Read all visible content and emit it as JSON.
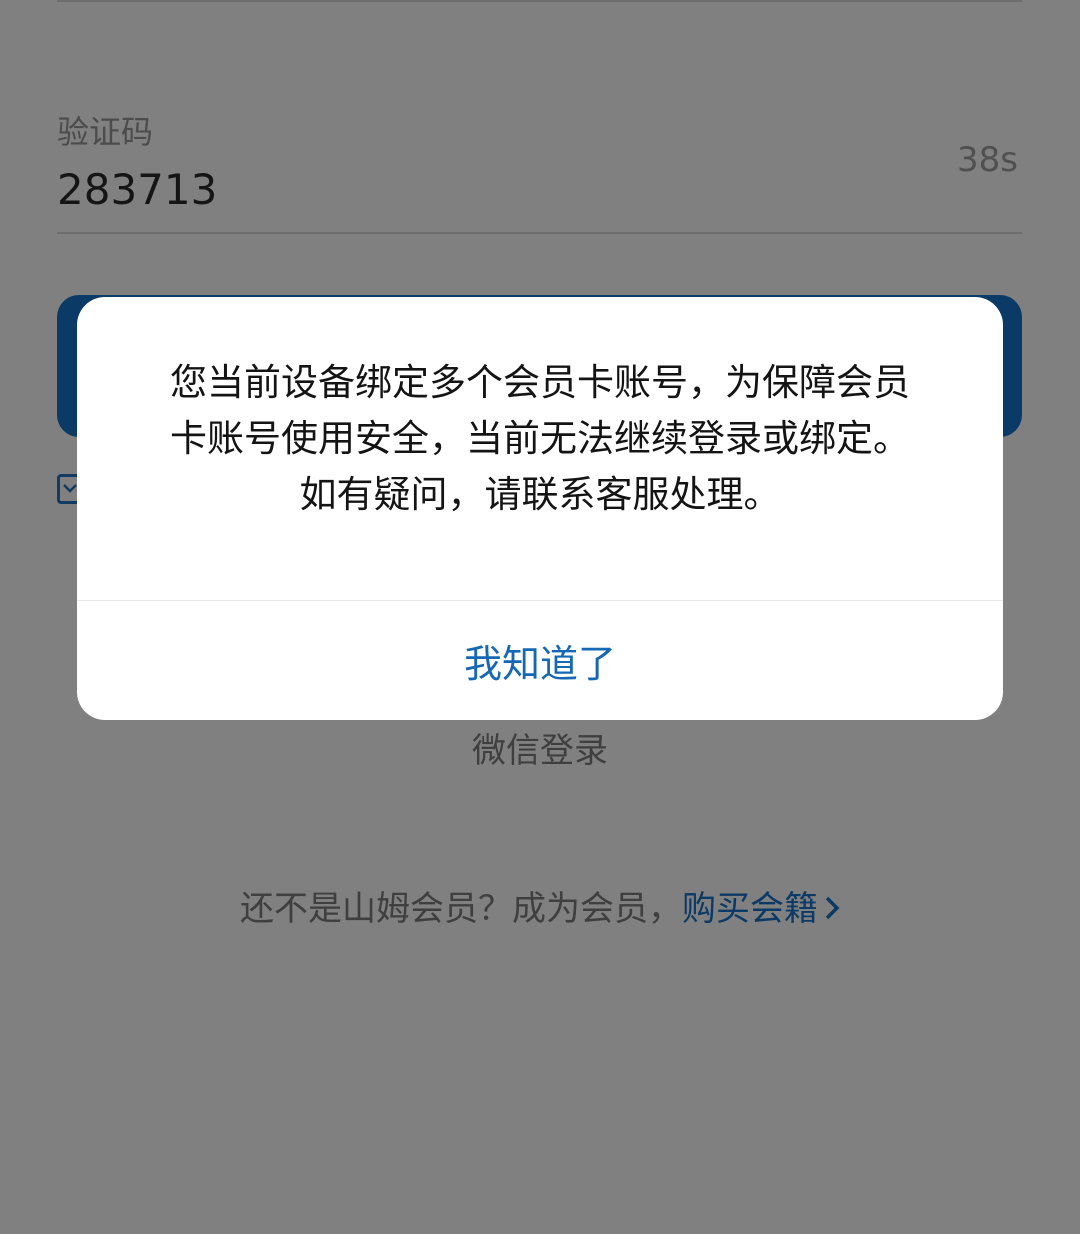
{
  "form": {
    "code_label": "验证码",
    "code_value": "283713",
    "countdown": "38s"
  },
  "wechat_login_label": "微信登录",
  "member_prompt": {
    "prefix": "还不是山姆会员？成为会员，",
    "buy_link": "购买会籍"
  },
  "dialog": {
    "message_lines": [
      "您当前设备绑定多个会员卡账号，为保障会员",
      "卡账号使用安全，当前无法继续登录或绑定。",
      "如有疑问，请联系客服处理。"
    ],
    "confirm_label": "我知道了"
  },
  "colors": {
    "overlay_gray": "#808080",
    "brand_blue": "#0c3a66",
    "dialog_button_blue": "#1668b4"
  },
  "icons": {
    "checkbox": "checkbox-checked-icon",
    "chevron": "chevron-right-icon"
  }
}
